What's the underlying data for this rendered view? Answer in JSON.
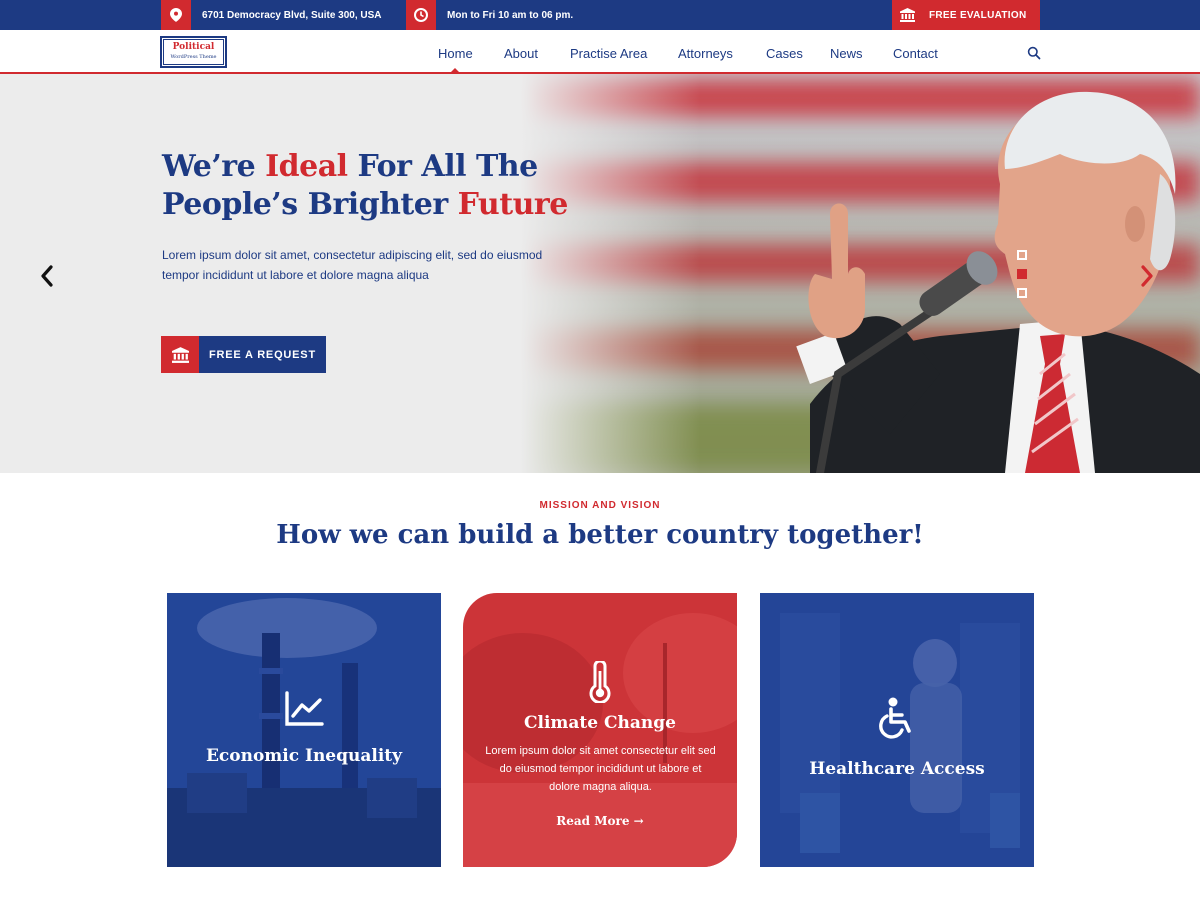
{
  "topbar": {
    "address": "6701 Democracy Blvd, Suite 300, USA",
    "hours": "Mon to Fri 10 am to 06 pm.",
    "evaluation_label": "FREE EVALUATION"
  },
  "logo": {
    "title": "Political",
    "subtitle": "WordPress Theme"
  },
  "nav": {
    "items": [
      "Home",
      "About",
      "Practise Area",
      "Attorneys",
      "Cases",
      "News",
      "Contact"
    ],
    "active": "Home"
  },
  "hero": {
    "title_part1": "We’re ",
    "title_highlight1": "Ideal",
    "title_part2": " For All The People’s Brighter ",
    "title_highlight2": "Future",
    "description": "Lorem ipsum dolor sit amet, consectetur adipiscing elit, sed do eiusmod tempor incididunt ut labore et dolore magna aliqua",
    "cta_label": "FREE A REQUEST",
    "slides_count": 3,
    "active_slide": 2
  },
  "mission": {
    "kicker": "MISSION AND VISION",
    "title": "How we can build a better country together!"
  },
  "cards": [
    {
      "title": "Economic Inequality",
      "icon": "line-chart-icon"
    },
    {
      "title": "Climate Change",
      "icon": "thermometer-icon",
      "text": "Lorem ipsum dolor sit amet consectetur elit sed do eiusmod tempor incididunt ut labore et dolore magna aliqua.",
      "link": "Read More →"
    },
    {
      "title": "Healthcare Access",
      "icon": "wheelchair-icon"
    }
  ],
  "colors": {
    "brand_blue": "#1d3a83",
    "accent_red": "#d12a2f"
  }
}
